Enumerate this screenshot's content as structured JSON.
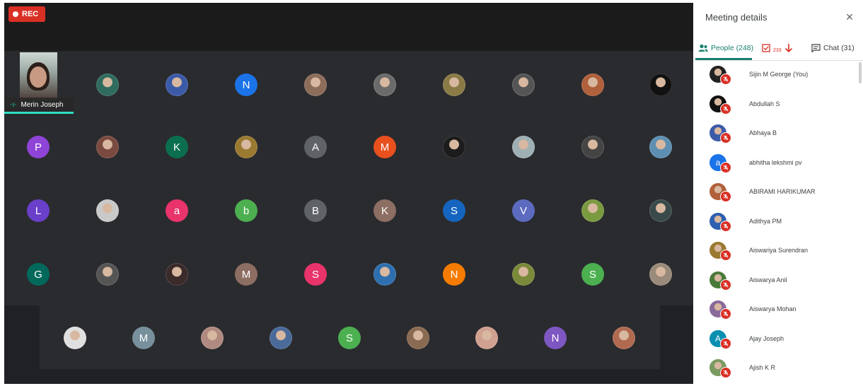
{
  "recording": {
    "label": "REC"
  },
  "self_tile": {
    "name": "Merin Joseph"
  },
  "panel": {
    "title": "Meeting details",
    "tabs": {
      "people": "People (248)",
      "activity_count": "233",
      "chat": "Chat (31)"
    }
  },
  "colors": {
    "accent": "#1a7f6e",
    "rec": "#d93025",
    "stage": "#202124"
  },
  "grid_rows": [
    [
      {
        "type": "photo",
        "color": "#2f6b5e"
      },
      {
        "type": "photo",
        "color": "#3b5aa8"
      },
      {
        "type": "letter",
        "letter": "N",
        "color": "#1a73e8"
      },
      {
        "type": "photo",
        "color": "#8c6d5a"
      },
      {
        "type": "photo",
        "color": "#6b6b6b"
      },
      {
        "type": "photo",
        "color": "#8a7a45"
      },
      {
        "type": "photo",
        "color": "#555555"
      },
      {
        "type": "photo",
        "color": "#b0603a"
      },
      {
        "type": "photo",
        "color": "#111111"
      }
    ],
    [
      {
        "type": "letter",
        "letter": "P",
        "color": "#8e44d6"
      },
      {
        "type": "photo",
        "color": "#7a4a40"
      },
      {
        "type": "letter",
        "letter": "K",
        "color": "#0b6e4f"
      },
      {
        "type": "photo",
        "color": "#9a7a30"
      },
      {
        "type": "letter",
        "letter": "A",
        "color": "#5f6368"
      },
      {
        "type": "letter",
        "letter": "M",
        "color": "#e8501e"
      },
      {
        "type": "photo",
        "color": "#1c1c1c"
      },
      {
        "type": "photo",
        "color": "#9fb0b4"
      },
      {
        "type": "photo",
        "color": "#444444"
      },
      {
        "type": "photo",
        "color": "#5d8fb2"
      }
    ],
    [
      {
        "type": "letter",
        "letter": "L",
        "color": "#6a3fc9"
      },
      {
        "type": "photo",
        "color": "#c9c9c9"
      },
      {
        "type": "letter",
        "letter": "a",
        "color": "#e8336b"
      },
      {
        "type": "letter",
        "letter": "b",
        "color": "#4caf50"
      },
      {
        "type": "letter",
        "letter": "B",
        "color": "#5f6368"
      },
      {
        "type": "letter",
        "letter": "K",
        "color": "#8d6e63"
      },
      {
        "type": "letter",
        "letter": "S",
        "color": "#1565c0"
      },
      {
        "type": "letter",
        "letter": "V",
        "color": "#5c6bc0"
      },
      {
        "type": "photo",
        "color": "#7a9a40"
      },
      {
        "type": "photo",
        "color": "#3a4a4a"
      }
    ],
    [
      {
        "type": "letter",
        "letter": "G",
        "color": "#00695c"
      },
      {
        "type": "photo",
        "color": "#555555"
      },
      {
        "type": "photo",
        "color": "#3a2a2a"
      },
      {
        "type": "letter",
        "letter": "M",
        "color": "#8d6e63"
      },
      {
        "type": "letter",
        "letter": "S",
        "color": "#e8336b"
      },
      {
        "type": "photo",
        "color": "#2e6fb0"
      },
      {
        "type": "letter",
        "letter": "N",
        "color": "#f57c00"
      },
      {
        "type": "photo",
        "color": "#7a8a3a"
      },
      {
        "type": "letter",
        "letter": "S",
        "color": "#4caf50"
      },
      {
        "type": "photo",
        "color": "#9a8a7a"
      }
    ]
  ],
  "bottom_row": [
    {
      "type": "photo",
      "color": "#e0e0e0"
    },
    {
      "type": "letter",
      "letter": "M",
      "color": "#78909c"
    },
    {
      "type": "photo",
      "color": "#b08a80"
    },
    {
      "type": "photo",
      "color": "#4a6a9a"
    },
    {
      "type": "letter",
      "letter": "S",
      "color": "#4caf50"
    },
    {
      "type": "photo",
      "color": "#8a6a50"
    },
    {
      "type": "photo",
      "color": "#d0a090"
    },
    {
      "type": "letter",
      "letter": "N",
      "color": "#7e57c2"
    },
    {
      "type": "photo",
      "color": "#b06a50"
    }
  ],
  "people": [
    {
      "name": "Sijin M George (You)",
      "color": "#222222",
      "letter": ""
    },
    {
      "name": "Abdullah S",
      "color": "#111111",
      "letter": ""
    },
    {
      "name": "Abhaya B",
      "color": "#3b5aa8",
      "letter": ""
    },
    {
      "name": "abhitha lekshmi pv",
      "color": "#1a73e8",
      "letter": "a"
    },
    {
      "name": "ABIRAMI HARIKUMAR",
      "color": "#b0603a",
      "letter": ""
    },
    {
      "name": "Adithya PM",
      "color": "#2e5fb0",
      "letter": ""
    },
    {
      "name": "Aiswariya Surendran",
      "color": "#9a7a30",
      "letter": ""
    },
    {
      "name": "Aiswarya Anil",
      "color": "#4a7a3a",
      "letter": ""
    },
    {
      "name": "Aiswarya Mohan",
      "color": "#8a6a9a",
      "letter": ""
    },
    {
      "name": "Ajay Joseph",
      "color": "#0b8fb0",
      "letter": "A"
    },
    {
      "name": "Ajish K R",
      "color": "#7a9a60",
      "letter": ""
    }
  ]
}
